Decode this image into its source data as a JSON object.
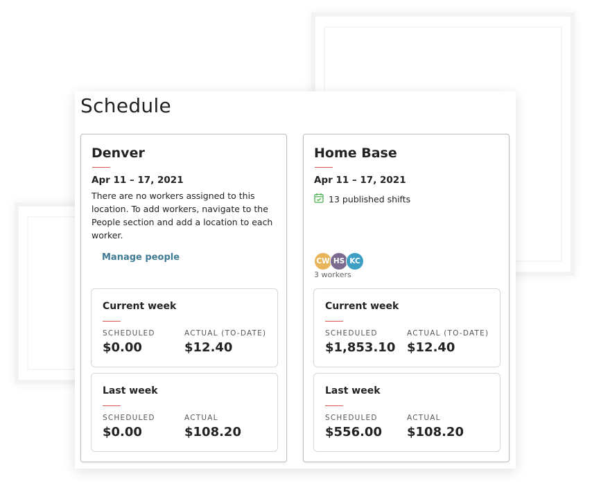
{
  "page": {
    "title": "Schedule"
  },
  "colors": {
    "accent_line": "#d9534f",
    "link": "#3f7a93",
    "avatar_cw": "#e8b55a",
    "avatar_hs": "#7d6a8f",
    "avatar_kc": "#3f9ec4",
    "calendar_icon": "#4caf50"
  },
  "locations": [
    {
      "name": "Denver",
      "date_range": "Apr 11 – 17, 2021",
      "empty_message": "There are no workers assigned to this location. To add workers, navigate to the People section and add a location to each worker.",
      "manage_link": "Manage people",
      "current_week": {
        "title": "Current week",
        "scheduled_label": "SCHEDULED",
        "scheduled_value": "$0.00",
        "actual_label": "ACTUAL (TO-DATE)",
        "actual_value": "$12.40"
      },
      "last_week": {
        "title": "Last week",
        "scheduled_label": "SCHEDULED",
        "scheduled_value": "$0.00",
        "actual_label": "ACTUAL",
        "actual_value": "$108.20"
      }
    },
    {
      "name": "Home Base",
      "date_range": "Apr 11 – 17, 2021",
      "shifts_icon": "calendar-check-icon",
      "shifts_text": "13 published shifts",
      "avatars": [
        "CW",
        "HS",
        "KC"
      ],
      "workers_count": "3 workers",
      "current_week": {
        "title": "Current week",
        "scheduled_label": "SCHEDULED",
        "scheduled_value": "$1,853.10",
        "actual_label": "ACTUAL (TO-DATE)",
        "actual_value": "$12.40"
      },
      "last_week": {
        "title": "Last week",
        "scheduled_label": "SCHEDULED",
        "scheduled_value": "$556.00",
        "actual_label": "ACTUAL",
        "actual_value": "$108.20"
      }
    }
  ]
}
